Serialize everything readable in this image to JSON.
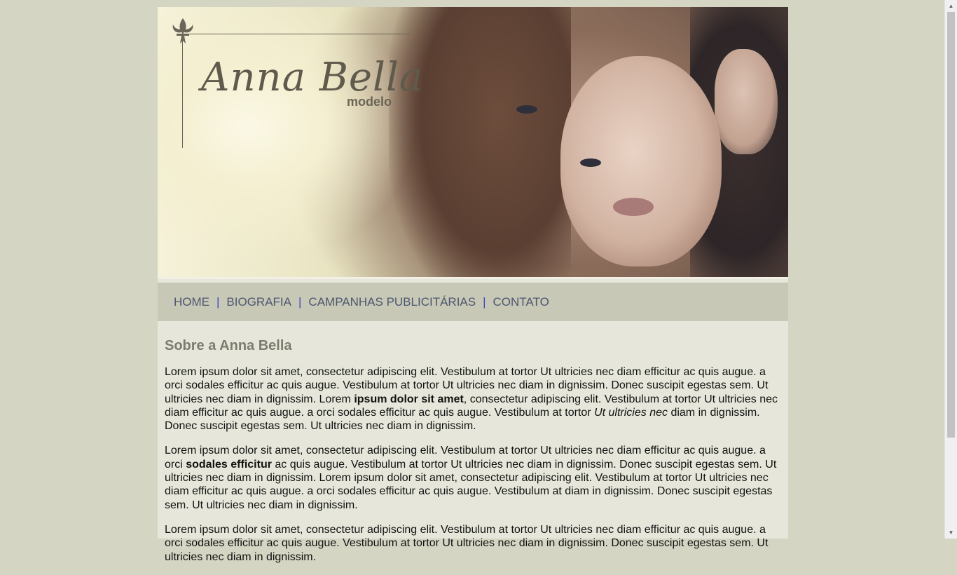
{
  "header": {
    "logo_name": "Anna Bella",
    "logo_sub": "modelo"
  },
  "nav": {
    "items": [
      {
        "label": "HOME"
      },
      {
        "label": "BIOGRAFIA"
      },
      {
        "label": "CAMPANHAS PUBLICITÁRIAS"
      },
      {
        "label": "CONTATO"
      }
    ],
    "separator": "|"
  },
  "content": {
    "title": "Sobre a Anna Bella",
    "p1": [
      "Lorem ipsum dolor sit amet, consectetur adipiscing elit. Vestibulum at tortor Ut ultricies nec diam efficitur ac quis augue. a orci sodales efficitur ac quis augue. Vestibulum at tortor Ut ultricies nec diam in dignissim. Donec suscipit egestas sem. Ut ultricies nec diam in dignissim. Lorem ",
      "ipsum dolor sit amet",
      ", consectetur adipiscing elit. Vestibulum at tortor Ut ultricies nec diam efficitur ac quis augue. a orci sodales efficitur ac quis augue. Vestibulum at tortor ",
      "Ut ultricies nec",
      " diam in dignissim. Donec suscipit egestas sem. Ut ultricies nec diam in dignissim."
    ],
    "p2": [
      "Lorem ipsum dolor sit amet, consectetur adipiscing elit. Vestibulum at tortor Ut ultricies nec diam efficitur ac quis augue. a orci ",
      "sodales efficitur",
      " ac quis augue. Vestibulum at tortor Ut ultricies nec diam in dignissim. Donec suscipit egestas sem. Ut ultricies nec diam in dignissim. Lorem ipsum dolor sit amet, consectetur adipiscing elit. Vestibulum at tortor Ut ultricies nec diam efficitur ac quis augue. a orci sodales efficitur ac quis augue. Vestibulum at diam in dignissim. Donec suscipit egestas sem. Ut ultricies nec diam in dignissim."
    ],
    "p3": "Lorem ipsum dolor sit amet, consectetur adipiscing elit. Vestibulum at tortor Ut ultricies nec diam efficitur ac quis augue. a orci sodales efficitur ac quis augue. Vestibulum at tortor Ut ultricies nec diam in dignissim. Donec suscipit egestas sem. Ut ultricies nec diam in dignissim."
  },
  "colors": {
    "page_bg": "#d4d5c3",
    "content_bg": "#e6e7da",
    "nav_bg": "#c7c8b5",
    "nav_text": "#4d5770",
    "nav_separator": "#3f47c0",
    "heading": "#7c7c6e"
  }
}
